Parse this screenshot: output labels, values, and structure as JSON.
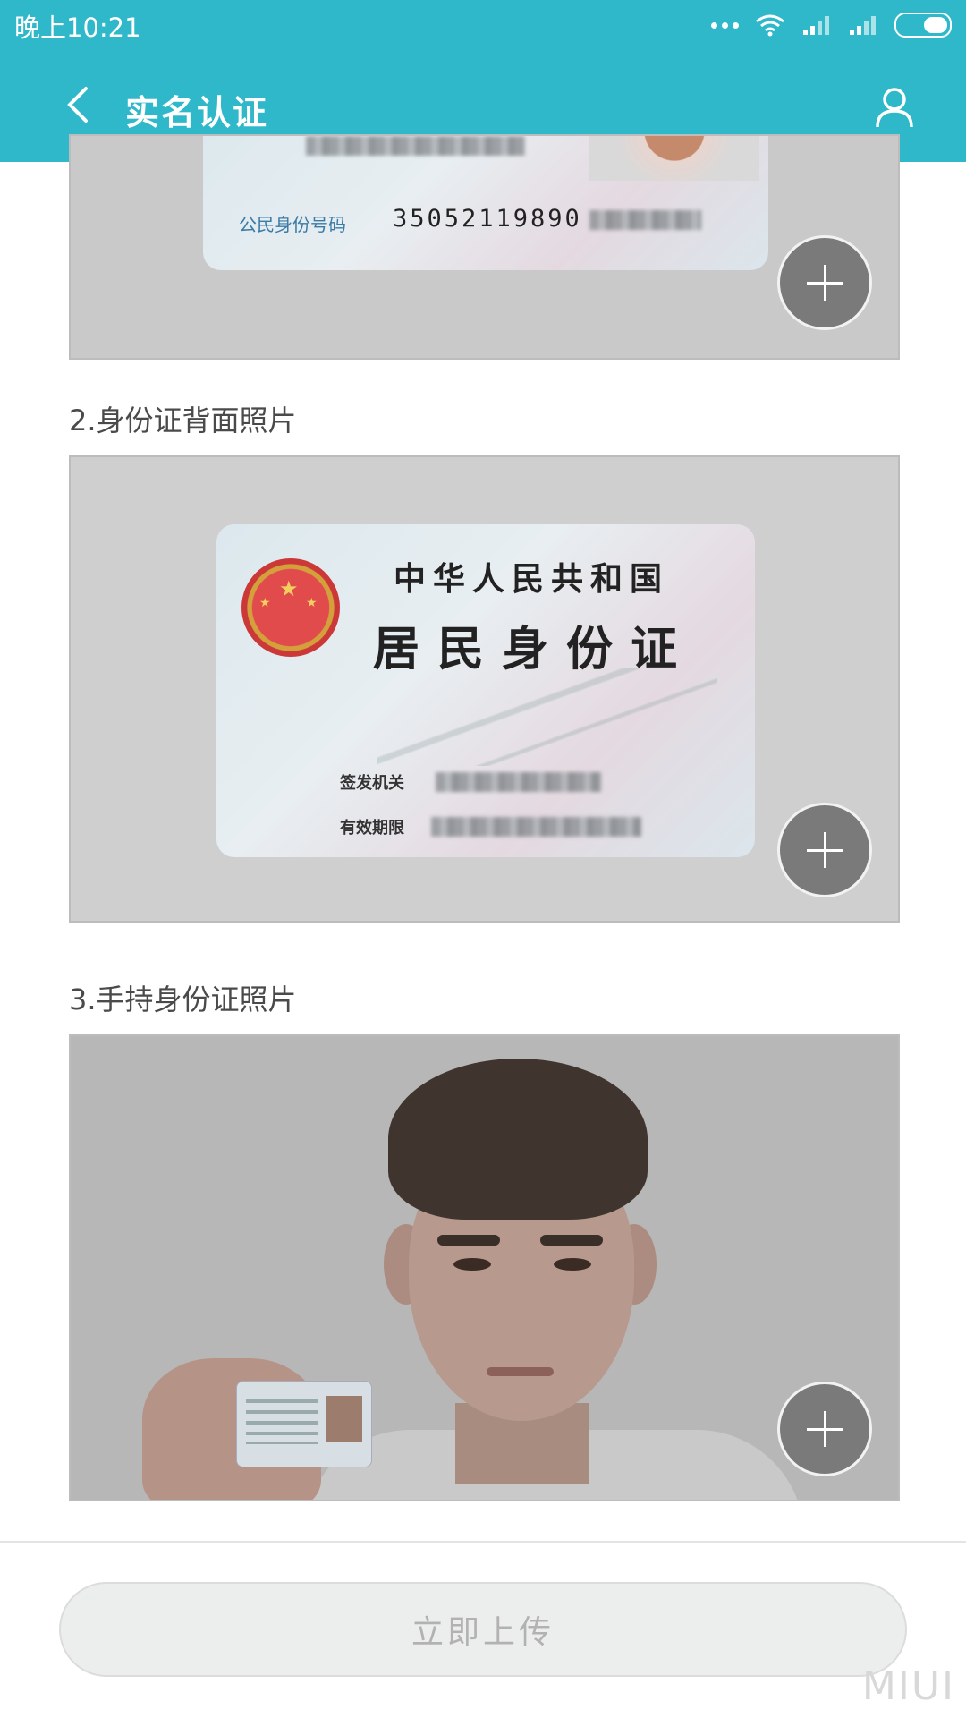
{
  "status_bar": {
    "time": "晚上10:21"
  },
  "header": {
    "title": "实名认证"
  },
  "sections": [
    {
      "card_front": {
        "label": "公民身份号码",
        "number": "35052119890"
      }
    },
    {
      "label": "2.身份证背面照片",
      "card_back": {
        "country": "中华人民共和国",
        "card_name": "居民身份证",
        "issuer_label": "签发机关",
        "validity_label": "有效期限"
      }
    },
    {
      "label": "3.手持身份证照片"
    }
  ],
  "footer": {
    "upload_label": "立即上传"
  },
  "watermark": {
    "text": "MIUI"
  },
  "colors": {
    "header": "#2eb8c9",
    "button_bg": "#eceeed",
    "button_text": "#b2b2b2"
  }
}
